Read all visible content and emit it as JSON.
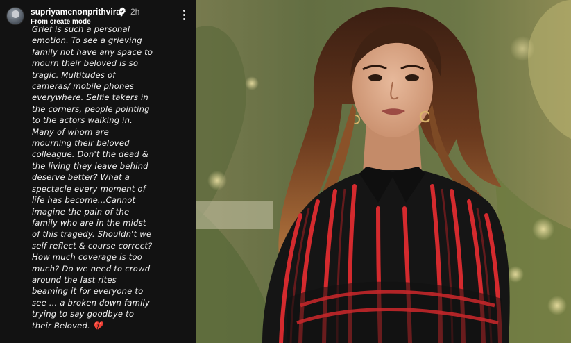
{
  "story": {
    "username": "supriyamenonprithviraj",
    "time": "2h",
    "subtitle": "From create mode",
    "text": "Grief is such a personal\nemotion. To see a grieving\nfamily not have any space to\nmourn their beloved is so\ntragic. Multitudes of\ncameras/ mobile phones\neverywhere. Selfie takers in\nthe corners, people pointing\nto the actors walking in.\nMany of whom are\nmourning their beloved\ncolleague. Don't the dead &\nthe living they leave behind\ndeserve better? What a\nspectacle every moment of\nlife has become...Cannot\nimagine the pain of the\nfamily who are in the midst\nof this tragedy. Shouldn't we\nself reflect & course correct?\nHow much coverage is too\nmuch? Do we need to crowd\naround the last rites\nbeaming it for everyone to\nsee ... a broken down family\ntrying to say goodbye to\ntheir Beloved. 💔"
  },
  "icons": {
    "verified": "verified-badge-icon",
    "more": "more-options-icon",
    "avatar": "profile-avatar"
  },
  "colors": {
    "story_bg": "#121212",
    "verified_blue": "#3897f0",
    "dress_red": "#d42a2e",
    "dress_black": "#151515"
  }
}
